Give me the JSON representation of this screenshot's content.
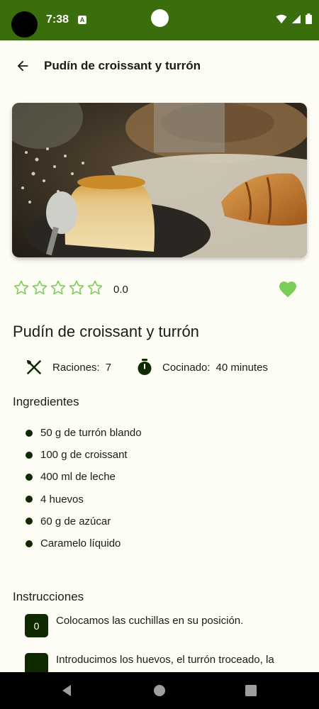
{
  "status_bar": {
    "time": "7:38",
    "notification_icon": "A"
  },
  "app_bar": {
    "title": "Pudín de croissant y turrón"
  },
  "rating": {
    "value": "0.0",
    "stars": 5,
    "filled": 0
  },
  "favorite": {
    "active": true
  },
  "recipe": {
    "title": "Pudín de croissant y turrón",
    "servings_label": "Raciones:",
    "servings_value": "7",
    "cooking_label": "Cocinado:",
    "cooking_value": "40 minutes"
  },
  "ingredients": {
    "heading": "Ingredientes",
    "items": [
      "50 g de turrón blando",
      "100 g de croissant",
      "400 ml de leche",
      "4 huevos",
      "60 g de azúcar",
      "Caramelo líquido"
    ]
  },
  "instructions": {
    "heading": "Instrucciones",
    "steps": [
      {
        "number": "0",
        "text": "Colocamos las cuchillas en su posición."
      },
      {
        "number": "",
        "text": "Introducimos los huevos, el turrón troceado, la"
      }
    ]
  },
  "colors": {
    "status_bar": "#3a6e0c",
    "accent_green": "#7ccc5a",
    "dark_green": "#0f2a00",
    "background": "#fdfcf5"
  },
  "icons": {
    "back": "arrow-left-icon",
    "star": "star-outline-icon",
    "favorite": "heart-icon",
    "servings": "utensils-icon",
    "time": "timer-icon"
  }
}
